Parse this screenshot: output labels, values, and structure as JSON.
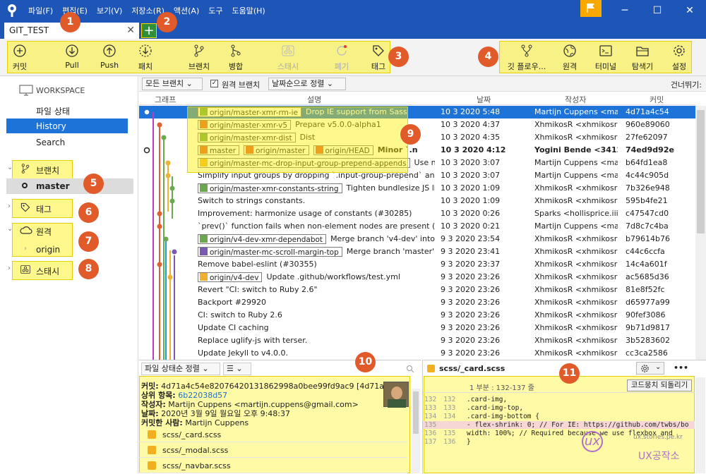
{
  "menu": [
    "파일(F)",
    "편집(E)",
    "보기(V)",
    "저장소(R)",
    "액션(A)",
    "도구",
    "도움말(H)"
  ],
  "window_controls": {
    "minimize": "─",
    "maximize": "☐",
    "close": "✕"
  },
  "tab": {
    "label": "GIT_TEST",
    "close": "✕",
    "add": "+"
  },
  "toolbar": {
    "commit": "커밋",
    "pull": "Pull",
    "push": "Push",
    "patch": "패치",
    "branch": "브랜치",
    "merge": "병합",
    "stash": "스태시",
    "discard": "폐기",
    "tag": "태그",
    "gitflow": "깃 플로우...",
    "remote": "원격",
    "terminal": "터미널",
    "explorer": "탐색기",
    "settings": "설정"
  },
  "badges": [
    "1",
    "2",
    "3",
    "4",
    "5",
    "6",
    "7",
    "8",
    "9",
    "10",
    "11"
  ],
  "sidebar": {
    "workspace": "WORKSPACE",
    "file_status": "파일 상태",
    "history": "History",
    "search": "Search",
    "branches": "브랜치",
    "master": "master",
    "tags": "태그",
    "remotes": "원격",
    "origin": "origin",
    "stashes": "스태시"
  },
  "filterbar": {
    "branch_filter": "모든 브랜치 ⌄",
    "remote_branch_check": "원격 브랜치",
    "sort": "날짜순으로 정렬 ⌄",
    "skip": "건너뛰기:"
  },
  "columns": {
    "graph": "그래프",
    "desc": "설명",
    "date": "날짜",
    "author": "작성자",
    "commit": "커밋"
  },
  "commits": [
    {
      "refs": [
        {
          "name": "origin/master-xmr-rm-ie",
          "color": "#6aa84f"
        }
      ],
      "msg": "Drop IE support from Sass",
      "date": "10 3 2020 5:48",
      "author": "Martijn Cuppens <mart",
      "hash": "4d71a4c54",
      "selected": true
    },
    {
      "refs": [
        {
          "name": "origin/master-xmr-v5",
          "color": "#e06030"
        }
      ],
      "msg": "Prepare v5.0.0-alpha1",
      "date": "10 3 2020 4:37",
      "author": "XhmikosR <xhmikosr@",
      "hash": "960e89060"
    },
    {
      "refs": [
        {
          "name": "origin/master-xmr-dist",
          "color": "#6aa84f"
        }
      ],
      "msg": "Dist",
      "date": "10 3 2020 4:35",
      "author": "XhmikosR <xhmikosr@",
      "hash": "27fe62097"
    },
    {
      "refs": [
        {
          "name": "master",
          "color": "#e06030"
        },
        {
          "name": "origin/master",
          "color": "#e06030"
        },
        {
          "name": "origin/HEAD",
          "color": "#e06030"
        }
      ],
      "msg": "Minor `.n",
      "date": "10 3 2020 4:12",
      "author": "Yogini Bende <341220",
      "hash": "74ed9d92e",
      "bold": true
    },
    {
      "refs": [
        {
          "name": "origin/master-mc-drop-input-group-prepend-appends",
          "color": "#f0b030"
        }
      ],
      "msg": "Use ne:",
      "date": "10 3 2020 3:07",
      "author": "Martijn Cuppens <mart",
      "hash": "b64fd1ea8"
    },
    {
      "refs": [],
      "msg": "Simplify input groups by dropping `.input-group-prepend` and `.i",
      "date": "10 3 2020 3:07",
      "author": "Martijn Cuppens <mart",
      "hash": "4c44c905d"
    },
    {
      "refs": [
        {
          "name": "origin/master-xmr-constants-string",
          "color": "#6aa84f"
        }
      ],
      "msg": "Tighten bundlesize JS lim",
      "date": "10 3 2020 1:09",
      "author": "XhmikosR <xhmikosr@",
      "hash": "7b326e948"
    },
    {
      "refs": [],
      "msg": "Switch to strings constants.",
      "date": "10 3 2020 1:09",
      "author": "XhmikosR <xhmikosr@",
      "hash": "595b4fe21"
    },
    {
      "refs": [],
      "msg": "Improvement: harmonize usage of constants (#30285)",
      "date": "10 3 2020 0:26",
      "author": "Sparks <hollisprice.iii@",
      "hash": "c47547cd0"
    },
    {
      "refs": [],
      "msg": "`prev()` function fails when non-element nodes are present (#301",
      "date": "10 3 2020 0:21",
      "author": "Martijn Cuppens <mart",
      "hash": "7d8c7c4ba"
    },
    {
      "refs": [
        {
          "name": "origin/v4-dev-xmr-dependabot",
          "color": "#6aa84f"
        }
      ],
      "msg": "Merge branch 'v4-dev' into v",
      "date": "9 3 2020 23:54",
      "author": "XhmikosR <xhmikosr@",
      "hash": "b79614b76"
    },
    {
      "refs": [
        {
          "name": "origin/master-mc-scroll-margin-top",
          "color": "#7a5ab0"
        }
      ],
      "msg": "Merge branch 'master' in",
      "date": "9 3 2020 23:41",
      "author": "XhmikosR <xhmikosr@",
      "hash": "c44c6ccfa"
    },
    {
      "refs": [],
      "msg": "Remove babel-eslint (#30355)",
      "date": "9 3 2020 23:37",
      "author": "XhmikosR <xhmikosr@",
      "hash": "14c4a601f"
    },
    {
      "refs": [
        {
          "name": "origin/v4-dev",
          "color": "#f0b030"
        }
      ],
      "msg": "Update .github/workflows/test.yml",
      "date": "9 3 2020 23:26",
      "author": "XhmikosR <xhmikosr@",
      "hash": "ac5685d36"
    },
    {
      "refs": [],
      "msg": "Revert \"CI: switch to Ruby 2.6\"",
      "date": "9 3 2020 23:26",
      "author": "XhmikosR <xhmikosr@",
      "hash": "81e8f52fc"
    },
    {
      "refs": [],
      "msg": "Backport #29920",
      "date": "9 3 2020 23:26",
      "author": "XhmikosR <xhmikosr@",
      "hash": "d65977a99"
    },
    {
      "refs": [],
      "msg": "CI: switch to Ruby 2.6",
      "date": "9 3 2020 23:26",
      "author": "XhmikosR <xhmikosr@",
      "hash": "90fef3086"
    },
    {
      "refs": [],
      "msg": "Update CI caching",
      "date": "9 3 2020 23:26",
      "author": "XhmikosR <xhmikosr@",
      "hash": "9b71d9817"
    },
    {
      "refs": [],
      "msg": "Replace uglify-js with terser.",
      "date": "9 3 2020 23:26",
      "author": "XhmikosR <xhmikosr@",
      "hash": "3b5283602"
    },
    {
      "refs": [],
      "msg": "Update Jekyll to v4.0.0.",
      "date": "9 3 2020 23:26",
      "author": "XhmikosR <xhmikosr@",
      "hash": "cc3ca2586"
    }
  ],
  "lower_left": {
    "sort": "파일 상태순 정렬 ⌄",
    "view": "☰ ⌄",
    "commit_label": "커밋:",
    "commit_value": "4d71a4c54e82076420131862998a0bee99fd9ac9 [4d71a4c]",
    "parent_label": "상위 항목:",
    "parent_value": "6b22038d57",
    "author_label": "작성자:",
    "author_value": "Martijn Cuppens <martijn.cuppens@gmail.com>",
    "date_label": "날짜:",
    "date_value": "2020년 3월 9일 월요일 오후 9:48:37",
    "committer_label": "커밋한 사람:",
    "committer_value": "Martijn Cuppens",
    "files": [
      "scss/_card.scss",
      "scss/_modal.scss",
      "scss/_navbar.scss"
    ]
  },
  "lower_right": {
    "filename": "scss/_card.scss",
    "hunk": "1 부분 : 132-137 줄",
    "revert_button": "코드뭉치 되돌리기",
    "more": "•••",
    "code": [
      {
        "a": "132",
        "b": "132",
        "t": "  .card-img,",
        "kind": "ctx"
      },
      {
        "a": "133",
        "b": "133",
        "t": "  .card-img-top,",
        "kind": "ctx"
      },
      {
        "a": "134",
        "b": "134",
        "t": "  .card-img-bottom {",
        "kind": "ctx"
      },
      {
        "a": "135",
        "b": "",
        "t": "-    flex-shrink: 0; // For IE: https://github.com/twbs/bo",
        "kind": "del"
      },
      {
        "a": "136",
        "b": "135",
        "t": "    width: 100%; // Required because we use flexbox and",
        "kind": "ctx"
      },
      {
        "a": "137",
        "b": "136",
        "t": "  }",
        "kind": "ctx"
      }
    ],
    "watermark_url": "ux.stories.pe.kr",
    "watermark_name": "UX공작소"
  }
}
